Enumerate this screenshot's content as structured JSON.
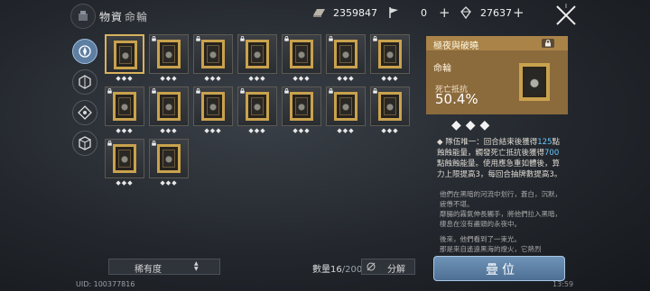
{
  "header": {
    "title": "物資",
    "subtitle": "命輪",
    "resources": [
      {
        "icon": "gold-bar-icon",
        "value": "2359847"
      },
      {
        "icon": "flag-icon",
        "value": "0"
      },
      {
        "icon": "crystal-icon",
        "value": "27637"
      }
    ],
    "plus": "+",
    "close_icon": "cross-swords-icon"
  },
  "sidebar": {
    "items": [
      {
        "name": "compass-tab",
        "active": true
      },
      {
        "name": "hexagon-tab",
        "active": false
      },
      {
        "name": "diamond-tab",
        "active": false
      },
      {
        "name": "cube-tab",
        "active": false
      }
    ]
  },
  "grid": {
    "rows": [
      [
        {
          "stars": "◆◆◆",
          "locked": false,
          "selected": true
        },
        {
          "stars": "◆◆◆",
          "locked": true
        },
        {
          "stars": "◆◆◆",
          "locked": true
        },
        {
          "stars": "◆◆◆",
          "locked": true
        },
        {
          "stars": "◆◆◆",
          "locked": true
        },
        {
          "stars": "◆◆◆",
          "locked": true
        },
        {
          "stars": "◆◆◆",
          "locked": true
        }
      ],
      [
        {
          "stars": "◆◆◆",
          "locked": true
        },
        {
          "stars": "◆◆◆",
          "locked": true
        },
        {
          "stars": "◆◆◆",
          "locked": true
        },
        {
          "stars": "◆◆◆",
          "locked": true
        },
        {
          "stars": "◆◆◆",
          "locked": true
        },
        {
          "stars": "◆◆◆",
          "locked": true
        },
        {
          "stars": "◆◆◆",
          "locked": true
        }
      ],
      [
        {
          "stars": "◆◆◆",
          "locked": true
        },
        {
          "stars": "◆◆◆",
          "locked": true
        }
      ]
    ]
  },
  "footer": {
    "sort_label": "稀有度",
    "sort_arrows": "▲▼",
    "count_label": "數量",
    "count_current": "16",
    "count_sep": "/",
    "count_max": "200",
    "decompose_label": "分解",
    "uid": "UID: 100377816",
    "time": "13:59"
  },
  "detail": {
    "name": "極夜與破曉",
    "category": "命輪",
    "stat_label": "死亡抵抗",
    "stat_value": "50.4%",
    "rarity": "◆◆◆",
    "desc_prefix": "◆ 隊伍唯一：回合結束後獲得",
    "desc_num1": "125",
    "desc_mid": "點蝕蝕能量，觸發死亡抵抗後獲得",
    "desc_num2": "700",
    "desc_suffix": "點蝕蝕能量。使用應急重如體後，算力上限提高3，每回合抽牌數提高3。",
    "lore_1": "他們在黑暗的河流中划行，蒼白，沉默，疲憊不堪。",
    "lore_2": "靡腸的霧氣伸長觸手，將他們拉入黑暗，棲息在沒有盡頭的永夜中。",
    "lore_3": "後來，他們看到了一束光。",
    "lore_4": "那是來自遙遠黑海的燈火，它熱烈",
    "stack_label": "疊位"
  }
}
